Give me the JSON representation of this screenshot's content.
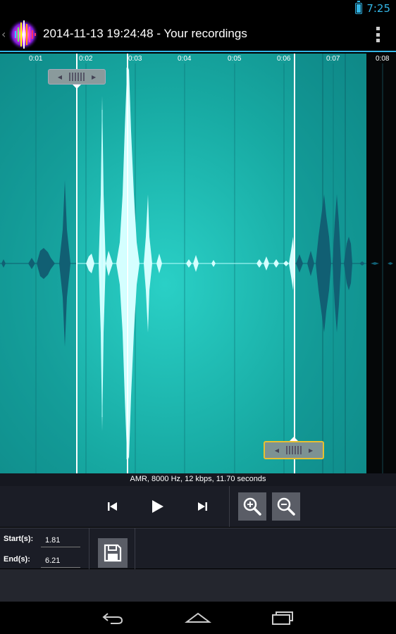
{
  "status_bar": {
    "time": "7:25",
    "battery_icon": "battery-charging-icon",
    "accent_color": "#33b5e5"
  },
  "action_bar": {
    "title": "2014-11-13 19:24:48 - Your recordings",
    "up_icon": "chevron-left-icon",
    "app_icon": "app-icon",
    "menu_icon": "overflow-menu-icon"
  },
  "waveform": {
    "time_ticks": [
      "0:01",
      "0:02",
      "0:03",
      "0:04",
      "0:05",
      "0:06",
      "0:07",
      "0:08"
    ],
    "background_color": "#1aa8a0",
    "selection_color": "#22c6bd",
    "waveform_dark_color": "#10677a",
    "waveform_light_color": "#c9ffff",
    "start_marker_seconds": 1.81,
    "end_marker_seconds": 6.21
  },
  "info": {
    "text": "AMR, 8000 Hz, 12 kbps, 11.70 seconds"
  },
  "controls": {
    "previous_icon": "skip-previous-icon",
    "play_icon": "play-icon",
    "next_icon": "skip-next-icon",
    "zoom_in_icon": "zoom-in-icon",
    "zoom_out_icon": "zoom-out-icon"
  },
  "edit": {
    "start_label": "Start(s):",
    "start_value": "1.81",
    "end_label": "End(s):",
    "end_value": "6.21",
    "save_icon": "save-icon"
  },
  "nav_bar": {
    "back_icon": "back-icon",
    "home_icon": "home-icon",
    "recents_icon": "recents-icon"
  }
}
